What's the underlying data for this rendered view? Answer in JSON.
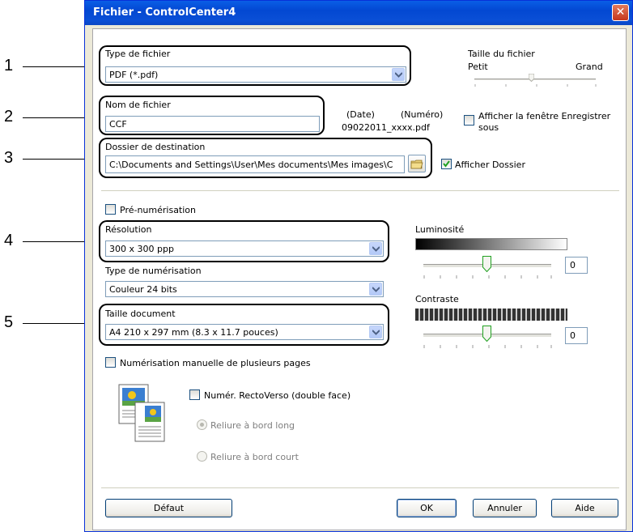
{
  "window": {
    "title": "Fichier - ControlCenter4",
    "close_glyph": "✕"
  },
  "callouts": [
    "1",
    "2",
    "3",
    "4",
    "5"
  ],
  "file_type": {
    "label": "Type de fichier",
    "value": "PDF (*.pdf)"
  },
  "file_size": {
    "label": "Taille du fichier",
    "small": "Petit",
    "large": "Grand"
  },
  "file_name": {
    "label": "Nom de fichier",
    "value": "CCF",
    "date_label": "(Date)",
    "number_label": "(Numéro)",
    "sample": "09022011_xxxx.pdf"
  },
  "show_save_as": {
    "label": "Afficher la fenêtre Enregistrer sous",
    "checked": false
  },
  "destination": {
    "label": "Dossier de destination",
    "value": "C:\\Documents and Settings\\User\\Mes documents\\Mes images\\C",
    "show_folder_label": "Afficher Dossier",
    "show_folder_checked": true
  },
  "prescan": {
    "label": "Pré-numérisation",
    "checked": false
  },
  "resolution": {
    "label": "Résolution",
    "value": "300 x 300 ppp"
  },
  "scan_type": {
    "label": "Type de numérisation",
    "value": "Couleur 24 bits"
  },
  "doc_size": {
    "label": "Taille document",
    "value": "A4 210 x 297 mm (8.3 x 11.7 pouces)"
  },
  "brightness": {
    "label": "Luminosité",
    "value": "0",
    "level": 0.5
  },
  "contrast": {
    "label": "Contraste",
    "value": "0",
    "level": 0.5
  },
  "multipage": {
    "label": "Numérisation manuelle de plusieurs pages",
    "checked": false
  },
  "duplex": {
    "label": "Numér. RectoVerso (double face)",
    "checked": false,
    "long_edge": "Reliure à bord long",
    "short_edge": "Reliure à bord court"
  },
  "buttons": {
    "default": "Défaut",
    "ok": "OK",
    "cancel": "Annuler",
    "help": "Aide"
  },
  "colors": {
    "titlebar": "#0348d2",
    "dialog_bg": "#ece9d8",
    "panel_bg": "#ffffff"
  }
}
